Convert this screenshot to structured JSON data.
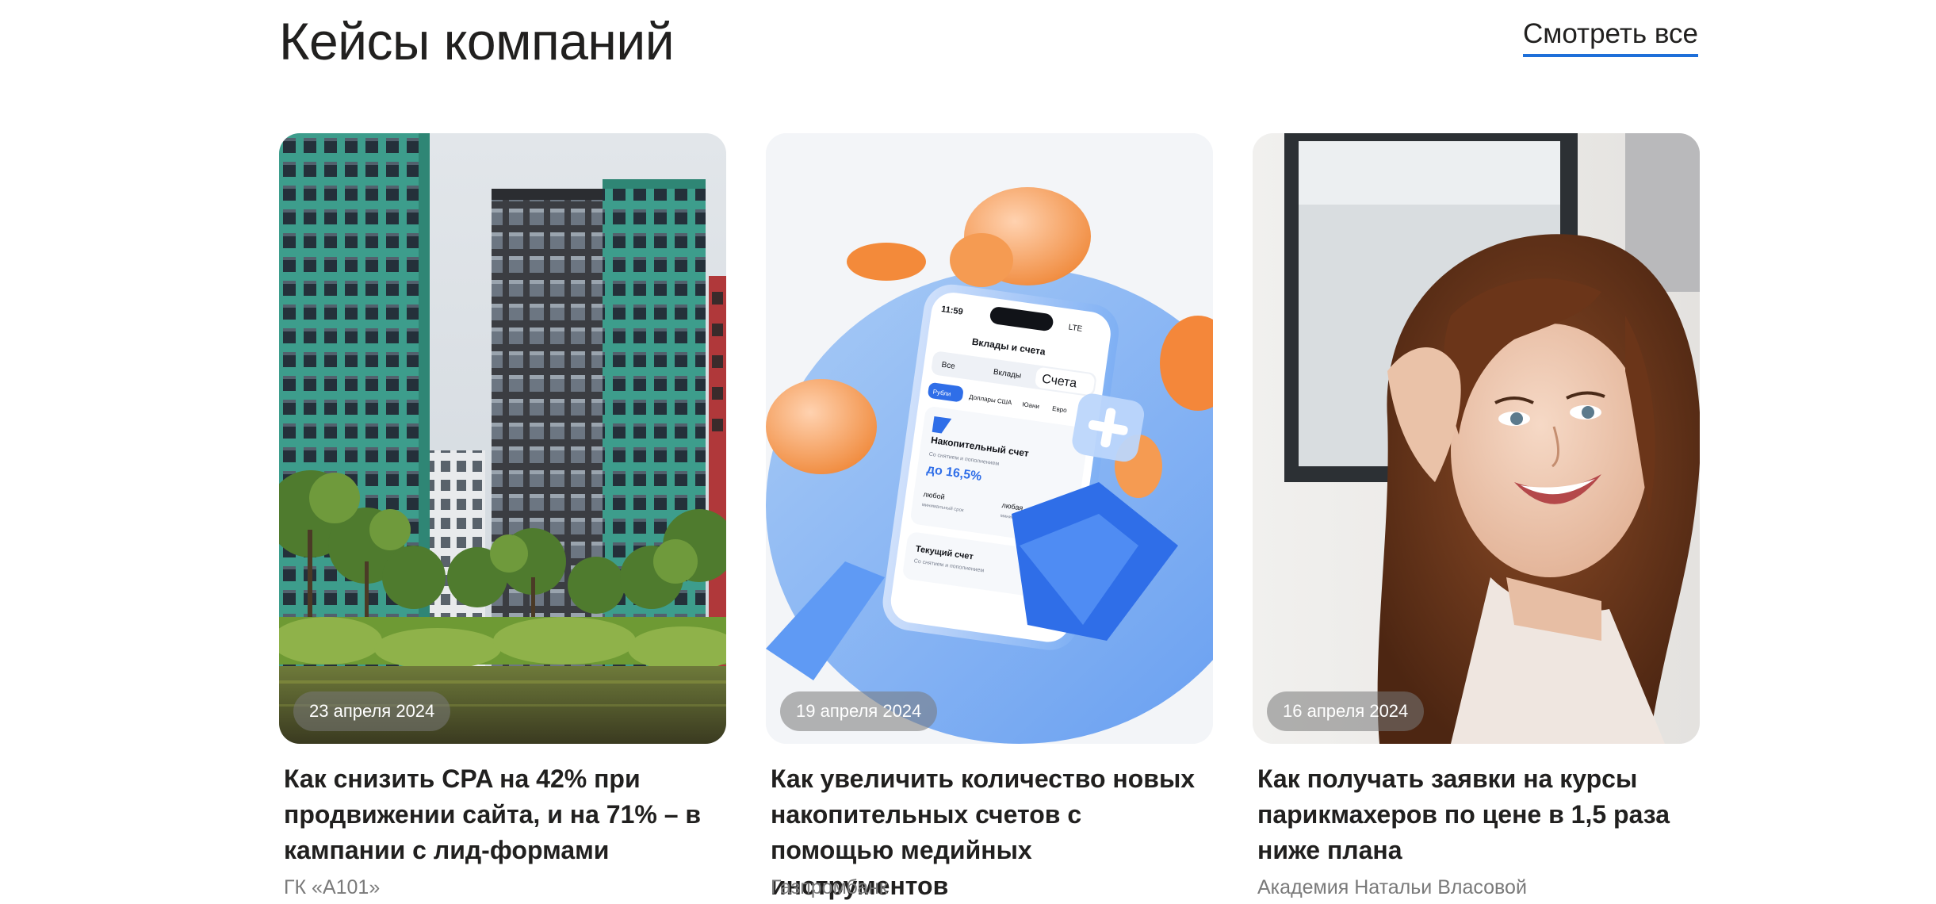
{
  "section": {
    "title": "Кейсы компаний",
    "see_all": "Смотреть все"
  },
  "cards": [
    {
      "date": "23 апреля 2024",
      "title": "Как снизить CPA на 42% при продвижении сайта, и на 71% – в кампании с лид-формами",
      "company": "ГК «А101»",
      "image": "residential-buildings-photo"
    },
    {
      "date": "19 апреля 2024",
      "title": "Как увеличить количество новых накопительных счетов с помощью медийных инструментов",
      "company": "Газпромбанк",
      "image": "banking-app-illustration",
      "phone": {
        "time": "11:59",
        "network": "LTE",
        "screen_title": "Вклады и счета",
        "tabs": [
          "Все",
          "Вклады",
          "Счета"
        ],
        "currencies": [
          "Рубли",
          "Доллары США",
          "Юани",
          "Евро"
        ],
        "account_name": "Накопительный счет",
        "account_sub": "Со снятием и пополнением",
        "rate": "до 16,5%",
        "term_value": "любой",
        "term_label": "минимальный срок",
        "sum_value": "любая",
        "sum_label": "минимальная сумма",
        "current_account": "Текущий счет",
        "current_sub": "Со снятием и пополнением"
      }
    },
    {
      "date": "16 апреля 2024",
      "title": "Как получать заявки на курсы парикмахеров по цене в 1,5 раза ниже плана",
      "company": "Академия Натальи Власовой",
      "image": "smiling-woman-photo"
    }
  ]
}
